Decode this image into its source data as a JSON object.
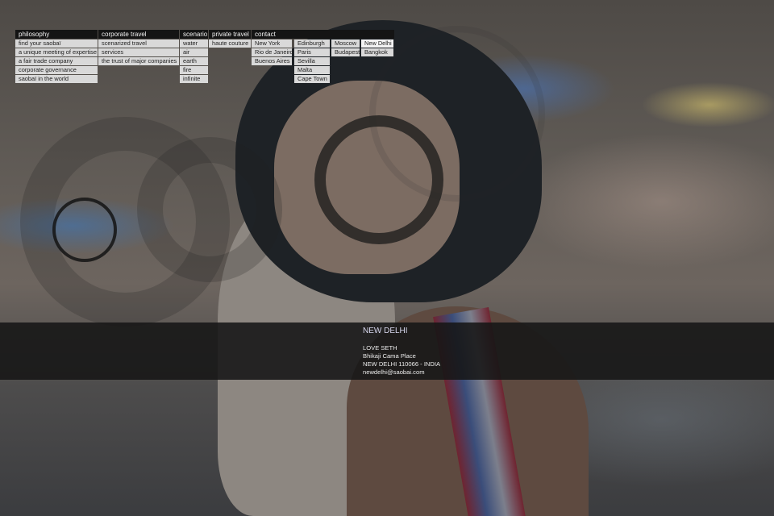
{
  "menu": {
    "philosophy": {
      "header": "philosophy",
      "items": [
        "find your saobaï",
        "a unique meeting of expertise",
        "a fair trade company",
        "corporate governance",
        "saobaï in the world"
      ]
    },
    "corporate_travel": {
      "header": "corporate travel",
      "items": [
        "scenarized travel",
        "services",
        "the trust of major companies"
      ]
    },
    "scenario": {
      "header": "scenario",
      "items": [
        "water",
        "air",
        "earth",
        "fire",
        "infinite"
      ]
    },
    "private_travel": {
      "header": "private travel",
      "items": [
        "haute couture"
      ]
    },
    "contact": {
      "header": "contact",
      "col1": [
        "New York",
        "Rio de Janeiro",
        "Buenos Aires"
      ],
      "col2": [
        "Edinburgh",
        "Paris",
        "Sevilla",
        "Malta",
        "Cape Town"
      ],
      "col3": [
        "Moscow",
        "Budapest"
      ],
      "col4": [
        "New Delhi",
        "Bangkok"
      ]
    }
  },
  "office": {
    "city": "NEW DELHI",
    "name": "LOVE SETH",
    "street": "Bhikaji Cama Place",
    "postal": "NEW DELHI 110066 - INDIA",
    "email": "newdelhi@saobai.com"
  }
}
